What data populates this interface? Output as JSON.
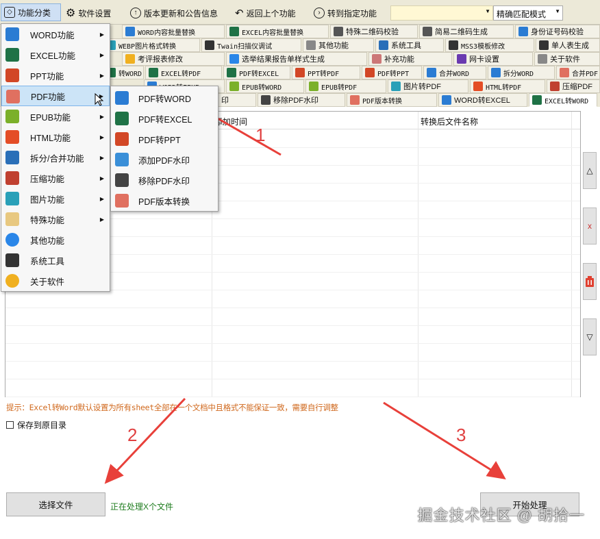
{
  "toolbar": {
    "categories": "功能分类",
    "settings": "软件设置",
    "update": "版本更新和公告信息",
    "back": "返回上个功能",
    "goto": "转到指定功能",
    "search_value": "",
    "match_mode": "精确匹配模式"
  },
  "tabs": {
    "row1": [
      "WORD内容批量替换",
      "EXCEL内容批量替换",
      "特殊二维码校验",
      "简易二维码生成",
      "身份证号码校验"
    ],
    "row2": [
      "WEBP图片格式转换",
      "Twain扫描仪调试",
      "其他功能",
      "系统工具",
      "MSS3模板修改",
      "单人表生成"
    ],
    "row3": [
      "考评报表修改",
      "选举结果报告单样式生成",
      "补充功能",
      "网卡设置",
      "关于软件"
    ],
    "row4": [
      "转WORD",
      "EXCEL转PDF",
      "PDF转EXCEL",
      "PPT转PDF",
      "PDF转PPT",
      "合并WORD",
      "拆分WORD",
      "合并PDF"
    ],
    "row5": [
      "WORD转EPUB",
      "EPUB转WORD",
      "EPUB转PDF",
      "图片转PDF",
      "HTML转PDF",
      "压缩PDF"
    ],
    "row6": [
      "印",
      "移除PDF水印",
      "PDF版本转换",
      "WORD转EXCEL",
      "EXCEL转WORD"
    ]
  },
  "grid": {
    "col_time": "添加时间",
    "col_output": "转换后文件名称"
  },
  "side_buttons": {
    "up": "△",
    "delete": "x",
    "clear": "",
    "down": "▽"
  },
  "hint": "提示：Excel转Word默认设置为所有sheet全部在一个文档中且格式不能保证一致，需要自行调整",
  "save_origin": "保存到原目录",
  "select_file": "选择文件",
  "status": "正在处理X个文件",
  "start": "开始处理",
  "watermark": "掘金技术社区 @ 胡拾一",
  "menu": [
    {
      "label": "WORD功能",
      "icon": "word-icon",
      "color": "#2b7cd3",
      "arrow": "▶"
    },
    {
      "label": "EXCEL功能",
      "icon": "excel-icon",
      "color": "#1f7246",
      "arrow": "▶"
    },
    {
      "label": "PPT功能",
      "icon": "ppt-icon",
      "color": "#d24726",
      "arrow": "▶"
    },
    {
      "label": "PDF功能",
      "icon": "pdf-icon",
      "color": "#e07060",
      "arrow": "▶"
    },
    {
      "label": "EPUB功能",
      "icon": "epub-icon",
      "color": "#7bb02a",
      "arrow": "▶"
    },
    {
      "label": "HTML功能",
      "icon": "html5-icon",
      "color": "#e44d26",
      "arrow": "▶"
    },
    {
      "label": "拆分/合并功能",
      "icon": "scissors-icon",
      "color": "#2a6fb8",
      "arrow": "▶"
    },
    {
      "label": "压缩功能",
      "icon": "layers-icon",
      "color": "#c04030",
      "arrow": "▶"
    },
    {
      "label": "图片功能",
      "icon": "image-icon",
      "color": "#2aa0b8",
      "arrow": "▶"
    },
    {
      "label": "特殊功能",
      "icon": "cloud-icon",
      "color": "#e8c880",
      "arrow": "▶"
    },
    {
      "label": "其他功能",
      "icon": "more-icon",
      "color": "#2a86e8",
      "arrow": ""
    },
    {
      "label": "系统工具",
      "icon": "gear-icon",
      "color": "#333333",
      "arrow": ""
    },
    {
      "label": "关于软件",
      "icon": "info-icon",
      "color": "#f0b020",
      "arrow": ""
    }
  ],
  "submenu": [
    {
      "label": "PDF转WORD",
      "icon": "word-icon",
      "color": "#2b7cd3"
    },
    {
      "label": "PDF转EXCEL",
      "icon": "excel-icon",
      "color": "#1f7246"
    },
    {
      "label": "PDF转PPT",
      "icon": "ppt-icon",
      "color": "#d24726"
    },
    {
      "label": "添加PDF水印",
      "icon": "watermark-add-icon",
      "color": "#3a8fd8"
    },
    {
      "label": "移除PDF水印",
      "icon": "watermark-remove-icon",
      "color": "#444444"
    },
    {
      "label": "PDF版本转换",
      "icon": "pdf-version-icon",
      "color": "#e07060"
    }
  ],
  "annotations": [
    "1",
    "2",
    "3"
  ]
}
